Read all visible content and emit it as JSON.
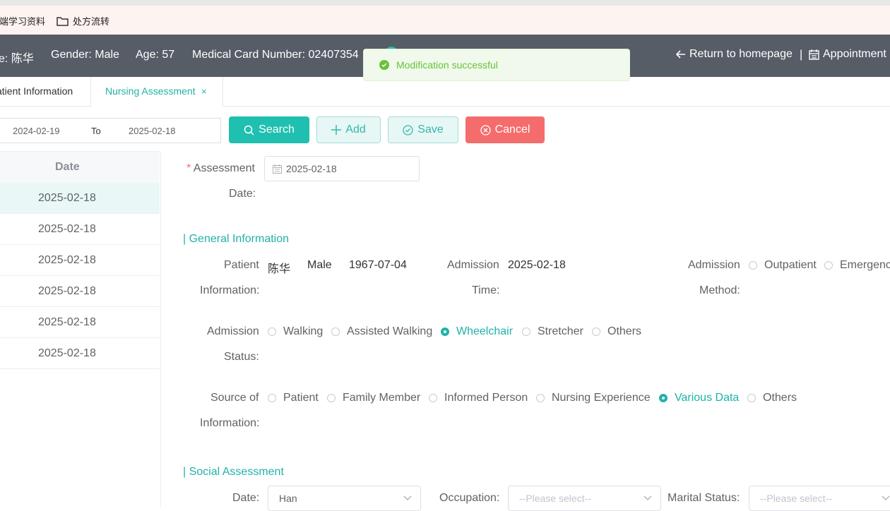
{
  "bookmarks": [
    {
      "label": "前端学习资料"
    },
    {
      "label": "处方流转"
    }
  ],
  "header": {
    "name": "e: 陈华",
    "gender": "Gender: Male",
    "age": "Age: 57",
    "card": "Medical Card Number: 02407354",
    "return_label": "Return to homepage",
    "separator": "|",
    "appointment_label": "Appointment"
  },
  "toast": {
    "message": "Modification successful",
    "color": "#67c23a"
  },
  "tabs": [
    {
      "label": "atient Information"
    },
    {
      "label": "Nursing Assessment",
      "active": true
    }
  ],
  "filter": {
    "from": "2024-02-19",
    "to_label": "To",
    "to": "2025-02-18"
  },
  "buttons": {
    "search": "Search",
    "add": "Add",
    "save": "Save",
    "cancel": "Cancel"
  },
  "list": {
    "header": "Date",
    "rows": [
      "2025-02-18",
      "2025-02-18",
      "2025-02-18",
      "2025-02-18",
      "2025-02-18",
      "2025-02-18"
    ],
    "selected_index": 0
  },
  "form": {
    "assessment_date_label_1": "Assessment",
    "assessment_date_label_2": "Date:",
    "assessment_date_value": "2025-02-18",
    "general_section": "| General Information",
    "patient_info_label_1": "Patient",
    "patient_info_label_2": "Information:",
    "patient_name": "陈华",
    "patient_gender": "Male",
    "patient_dob": "1967-07-04",
    "admission_time_label_1": "Admission",
    "admission_time_label_2": "Time:",
    "admission_time_value": "2025-02-18",
    "admission_method_label_1": "Admission",
    "admission_method_label_2": "Method:",
    "admission_method_options": [
      "Outpatient",
      "Emergenc"
    ],
    "admission_status_label_1": "Admission",
    "admission_status_label_2": "Status:",
    "admission_status_options": [
      "Walking",
      "Assisted Walking",
      "Wheelchair",
      "Stretcher",
      "Others"
    ],
    "admission_status_selected": "Wheelchair",
    "source_label_1": "Source of",
    "source_label_2": "Information:",
    "source_options": [
      "Patient",
      "Family Member",
      "Informed Person",
      "Nursing Experience",
      "Various Data",
      "Others"
    ],
    "source_selected": "Various Data",
    "social_section": "| Social Assessment",
    "ethnicity_label": "Date:",
    "ethnicity_value": "Han",
    "occupation_label": "Occupation:",
    "occupation_placeholder": "--Please select--",
    "marital_label": "Marital Status:",
    "marital_placeholder": "--Please select--"
  },
  "colors": {
    "accent": "#20b2a8",
    "header_bg": "#565d66",
    "danger": "#f56c6c"
  }
}
